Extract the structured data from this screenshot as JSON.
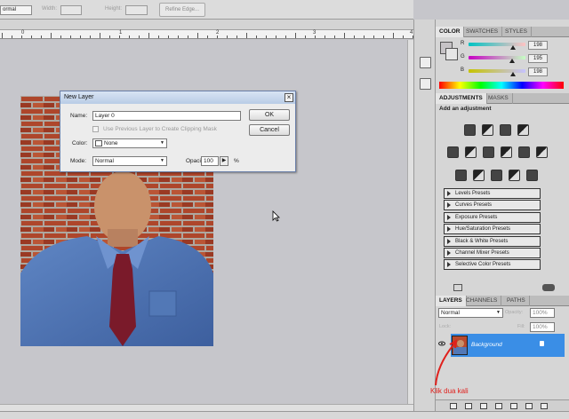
{
  "options_bar": {
    "style_value": "ormal",
    "width_label": "Width:",
    "height_label": "Height:",
    "refine_label": "Refine Edge..."
  },
  "ruler": {
    "labels": [
      "0",
      "1",
      "2",
      "3",
      "4"
    ]
  },
  "dialog": {
    "title": "New Layer",
    "name_label": "Name:",
    "name_value": "Layer 0",
    "clip_label": "Use Previous Layer to Create Clipping Mask",
    "color_label": "Color:",
    "color_value": "None",
    "mode_label": "Mode:",
    "mode_value": "Normal",
    "opacity_label": "Opacity:",
    "opacity_value": "100",
    "opacity_unit": "%",
    "ok_label": "OK",
    "cancel_label": "Cancel"
  },
  "color_panel": {
    "tabs": [
      "COLOR",
      "SWATCHES",
      "STYLES"
    ],
    "channels": [
      {
        "label": "R",
        "value": "198",
        "gradient": "linear-gradient(90deg,#00c3c3,#ffc3c3)",
        "pos": 0.78
      },
      {
        "label": "G",
        "value": "195",
        "gradient": "linear-gradient(90deg,#c600c3,#c6ffc3)",
        "pos": 0.76
      },
      {
        "label": "B",
        "value": "198",
        "gradient": "linear-gradient(90deg,#c6c300,#c6c3ff)",
        "pos": 0.78
      }
    ]
  },
  "adjustments_panel": {
    "tabs": [
      "ADJUSTMENTS",
      "MASKS"
    ],
    "heading": "Add an adjustment",
    "presets": [
      "Levels Presets",
      "Curves Presets",
      "Exposure Presets",
      "Hue/Saturation Presets",
      "Black & White Presets",
      "Channel Mixer Presets",
      "Selective Color Presets"
    ]
  },
  "layers_panel": {
    "tabs": [
      "LAYERS",
      "CHANNELS",
      "PATHS"
    ],
    "blend_mode": "Normal",
    "opacity_label": "Opacity:",
    "opacity_value": "100%",
    "lock_label": "Lock:",
    "fill_label": "Fill:",
    "fill_value": "100%",
    "layer_name": "Background"
  },
  "annotation": "Klik dua kali",
  "colors": {
    "selected_layer": "#3a8ee6",
    "annotation": "#e0201c",
    "dialog_title": "#c5d5ec"
  }
}
